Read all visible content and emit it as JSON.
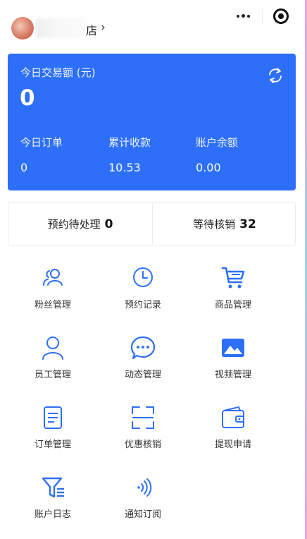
{
  "header": {
    "store_name": "店",
    "chevron": "›",
    "more_icon": "more-dots-icon",
    "close_icon": "target-close-icon"
  },
  "summary": {
    "title": "今日交易额 (元)",
    "today_amount": "0",
    "refresh_icon": "refresh-icon",
    "stats": [
      {
        "label": "今日订单",
        "value": "0"
      },
      {
        "label": "累计收款",
        "value": "10.53"
      },
      {
        "label": "账户余额",
        "value": "0.00"
      }
    ]
  },
  "pending": {
    "appointment_label": "预约待处理",
    "appointment_count": "0",
    "verify_label": "等待核销",
    "verify_count": "32"
  },
  "menu": [
    {
      "label": "粉丝管理",
      "icon": "fans-icon"
    },
    {
      "label": "预约记录",
      "icon": "clock-icon"
    },
    {
      "label": "商品管理",
      "icon": "cart-icon"
    },
    {
      "label": "员工管理",
      "icon": "person-icon"
    },
    {
      "label": "动态管理",
      "icon": "chat-bubble-icon"
    },
    {
      "label": "视频管理",
      "icon": "image-icon"
    },
    {
      "label": "订单管理",
      "icon": "document-icon"
    },
    {
      "label": "优惠核销",
      "icon": "scan-icon"
    },
    {
      "label": "提现申请",
      "icon": "wallet-icon"
    },
    {
      "label": "账户日志",
      "icon": "filter-list-icon"
    },
    {
      "label": "通知订阅",
      "icon": "sound-wave-icon"
    }
  ],
  "colors": {
    "accent": "#2d6ff9",
    "icon_blue": "#2d6ff9"
  }
}
